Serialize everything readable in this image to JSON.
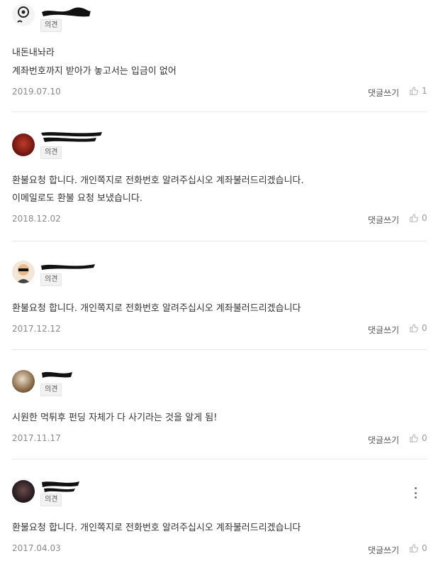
{
  "comments": [
    {
      "badge": "의견",
      "lines": [
        "내돈내놔라",
        "계좌번호까지 받아가 놓고서는 입금이 없어"
      ],
      "date": "2019.07.10",
      "reply": "댓글쓰기",
      "likes": "1"
    },
    {
      "badge": "의견",
      "lines": [
        "환불요청 합니다. 개인쪽지로 전화번호 알려주십시오 계좌불러드리겠습니다.",
        "이메일로도 환불 요청 보냈습니다."
      ],
      "date": "2018.12.02",
      "reply": "댓글쓰기",
      "likes": "0"
    },
    {
      "badge": "의견",
      "lines": [
        "환불요청 합니다. 개인쪽지로 전화번호 알려주십시오 계좌불러드리겠습니다"
      ],
      "date": "2017.12.12",
      "reply": "댓글쓰기",
      "likes": "0"
    },
    {
      "badge": "의견",
      "lines": [
        "시원한 먹튀후 펀딩 자체가 다 사기라는 것을 알게 됨!"
      ],
      "date": "2017.11.17",
      "reply": "댓글쓰기",
      "likes": "0"
    },
    {
      "badge": "의견",
      "lines": [
        "환불요청 합니다. 개인쪽지로 전화번호 알려주십시오 계좌불러드리겠습니다"
      ],
      "date": "2017.04.03",
      "reply": "댓글쓰기",
      "likes": "0"
    }
  ]
}
